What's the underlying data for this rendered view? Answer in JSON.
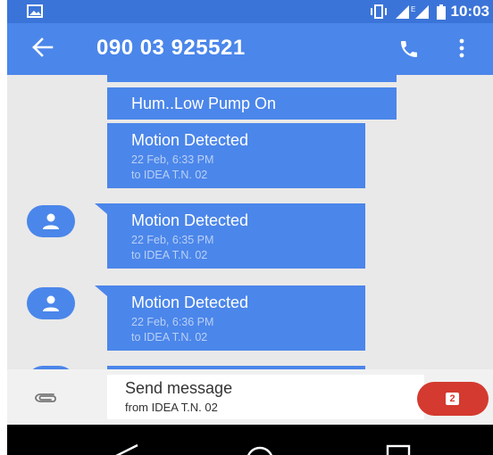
{
  "status_bar": {
    "time": "10:03"
  },
  "app_bar": {
    "title": "090 03 925521"
  },
  "messages": [
    {
      "text": "Hum..Low Pump On"
    },
    {
      "text": "Motion Detected",
      "time": "22 Feb, 6:33 PM",
      "recipient": "to IDEA T.N. 02"
    },
    {
      "text": "Motion Detected",
      "time": "22 Feb, 6:35 PM",
      "recipient": "to IDEA T.N. 02"
    },
    {
      "text": "Motion Detected",
      "time": "22 Feb, 6:36 PM",
      "recipient": "to IDEA T.N. 02"
    }
  ],
  "composer": {
    "placeholder": "Send message",
    "sim_label": "from IDEA T.N. 02",
    "sim_badge": "2"
  },
  "colors": {
    "status_bar": "#3b74d8",
    "app_bar": "#4b86ea",
    "bubble": "#4b86ea",
    "background": "#e9e9e9",
    "send_button": "#d43a2f"
  },
  "icons": [
    "image-icon",
    "vibrate-icon",
    "signal-icon",
    "battery-icon",
    "back-arrow-icon",
    "phone-icon",
    "more-vert-icon",
    "person-icon",
    "paperclip-icon",
    "nav-back-icon",
    "nav-home-icon",
    "nav-recents-icon"
  ]
}
